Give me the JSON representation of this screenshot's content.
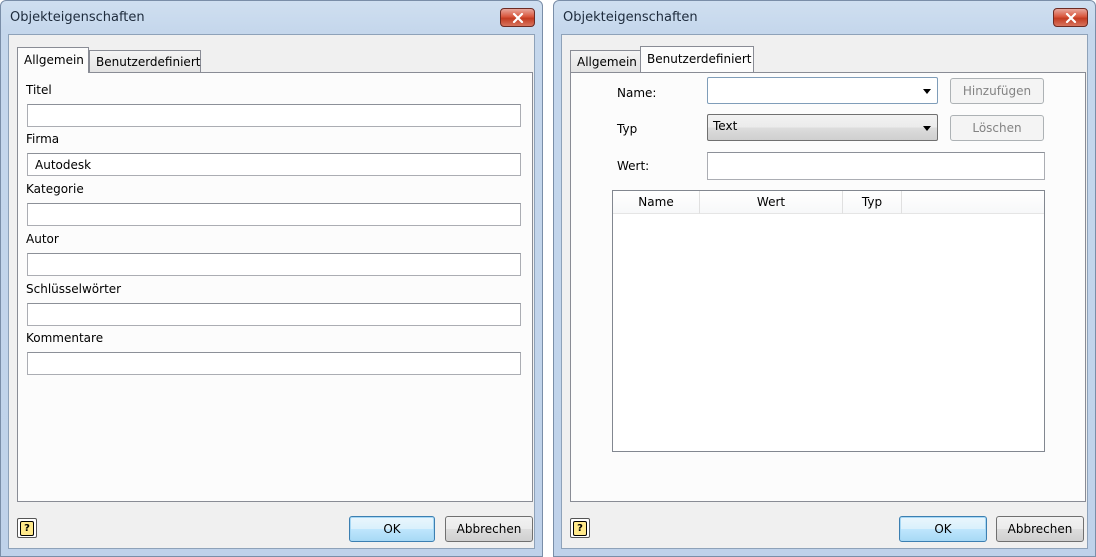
{
  "dialog_left": {
    "title": "Objekteigenschaften",
    "tabs": [
      {
        "label": "Allgemein",
        "active": true
      },
      {
        "label": "Benutzerdefiniert",
        "active": false
      }
    ],
    "fields": [
      {
        "label": "Titel",
        "value": ""
      },
      {
        "label": "Firma",
        "value": "Autodesk"
      },
      {
        "label": "Kategorie",
        "value": ""
      },
      {
        "label": "Autor",
        "value": ""
      },
      {
        "label": "Schlüsselwörter",
        "value": ""
      },
      {
        "label": "Kommentare",
        "value": ""
      }
    ],
    "ok_label": "OK",
    "cancel_label": "Abbrechen",
    "help_glyph": "?"
  },
  "dialog_right": {
    "title": "Objekteigenschaften",
    "tabs": [
      {
        "label": "Allgemein",
        "active": false
      },
      {
        "label": "Benutzerdefiniert",
        "active": true
      }
    ],
    "name_label": "Name:",
    "name_value": "",
    "typ_label": "Typ",
    "typ_value": "Text",
    "wert_label": "Wert:",
    "wert_value": "",
    "add_label": "Hinzufügen",
    "delete_label": "Löschen",
    "columns": [
      "Name",
      "Wert",
      "Typ"
    ],
    "ok_label": "OK",
    "cancel_label": "Abbrechen",
    "help_glyph": "?"
  },
  "colors": {
    "close_button": "#c9452b",
    "dialog_frame": "#bfd2ea",
    "client_background": "#f0f0f0",
    "default_button_border": "#3c7fb1"
  },
  "icons": {
    "close": "close-icon",
    "help": "help-icon",
    "dropdown": "chevron-down-icon"
  }
}
